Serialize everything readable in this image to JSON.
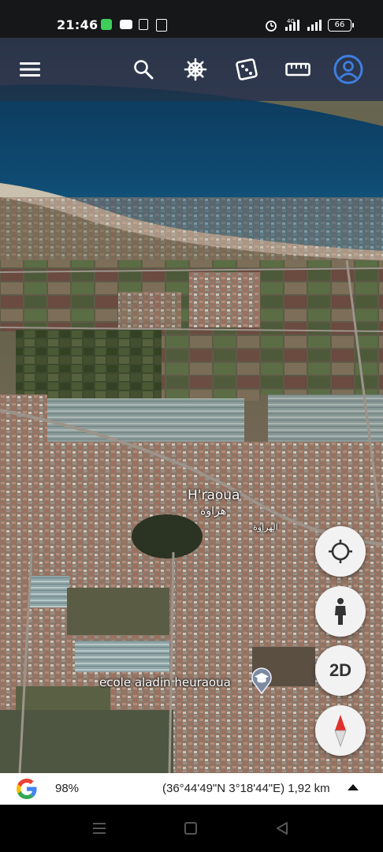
{
  "status_bar": {
    "time": "21:46",
    "battery": "66",
    "icons": [
      "messaging-icon",
      "video-icon",
      "sim-icon",
      "clipboard-icon",
      "alarm-icon",
      "4g-signal-icon",
      "signal-icon",
      "battery-icon"
    ]
  },
  "toolbar": {
    "icons": [
      "menu-icon",
      "search-icon",
      "voyager-wheel-icon",
      "dice-icon",
      "ruler-icon",
      "account-icon"
    ],
    "accent": "#3d7fe0"
  },
  "map": {
    "place_name": "H'raoua",
    "place_name_arabic": "هراوة",
    "road_label": "الهراوة",
    "school_label": "ecole aladin heuraoua",
    "school_icon": "graduation-cap-icon"
  },
  "fabs": {
    "locate_icon": "crosshair-icon",
    "street_view_icon": "pegman-icon",
    "view_mode_label": "2D",
    "compass_icon": "compass-icon"
  },
  "info_bar": {
    "logo": "google-logo-icon",
    "zoom": "98%",
    "coordinates": "(36°44'49\"N 3°18'44\"E) 1,92 km",
    "expand_icon": "caret-up-icon"
  },
  "nav_bar": {
    "icons": [
      "recent-apps-icon",
      "home-icon",
      "back-icon"
    ]
  }
}
